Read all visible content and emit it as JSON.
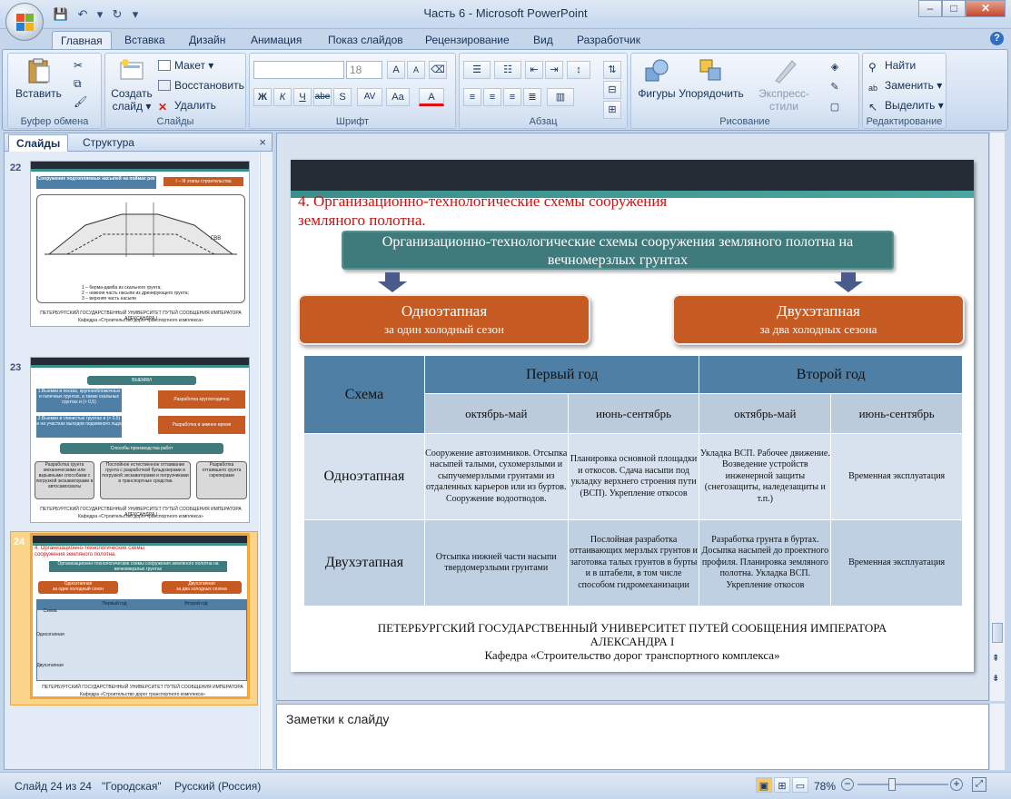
{
  "app": {
    "window_title": "Часть 6 - Microsoft PowerPoint"
  },
  "tabs": [
    "Главная",
    "Вставка",
    "Дизайн",
    "Анимация",
    "Показ слайдов",
    "Рецензирование",
    "Вид",
    "Разработчик"
  ],
  "ribbon": {
    "clipboard": {
      "paste": "Вставить",
      "label": "Буфер обмена"
    },
    "slides": {
      "create": "Создать",
      "create2": "слайд",
      "layout": "Макет",
      "reset": "Восстановить",
      "delete": "Удалить",
      "label": "Слайды"
    },
    "font": {
      "size": "18",
      "label": "Шрифт",
      "bold": "Ж",
      "italic": "К",
      "underline": "Ч",
      "strike": "abe",
      "shadow": "S",
      "grow": "A",
      "shrink": "A",
      "spacing": "AV",
      "case": "Aa",
      "color": "A"
    },
    "paragraph": {
      "label": "Абзац"
    },
    "drawing": {
      "shapes": "Фигуры",
      "arrange": "Упорядочить",
      "quick_styles": "Экспресс-стили",
      "label": "Рисование"
    },
    "editing": {
      "find": "Найти",
      "replace": "Заменить",
      "select": "Выделить",
      "label": "Редактирование"
    }
  },
  "panel": {
    "tab_slides": "Слайды",
    "tab_outline": "Структура",
    "thumbs": [
      {
        "num": "22",
        "title": "Сооружение подтопляемых насыпей на поймах рек",
        "badge": "I – III этапы строительства",
        "legend1": "1 – берма-дамба из скального грунта;",
        "legend2": "2 – нижняя часть насыпи из дренирующего грунта;",
        "legend3": "3 – верхняя часть насыпи",
        "footer": "ПЕТЕРБУРГСКИЙ ГОСУДАРСТВЕННЫЙ УНИВЕРСИТЕТ ПУТЕЙ СООБЩЕНИЯ ИМПЕРАТОРА АЛЕКСАНДРА I",
        "footer2": "Кафедра «Строительство дорог транспортного комплекса»",
        "gvv": "ГВВ"
      },
      {
        "num": "23",
        "head": "ВЫЕМКИ",
        "l1": "1.Выемки в песках, крупнообломочных и галечных грунтах, а также скальных грунтах и (> 0,5)",
        "r1": "Разработка круглогодично",
        "l2": "2.Выемки в глинистых грунтах и (> 0,5) и на участках выходов подземного льда",
        "r2": "Разработка в зимнее время",
        "methods": "Способы производства работ",
        "m1": "Разработка грунта механическими или взрывными способами с погрузкой экскаваторами в автосамосвалы",
        "m2": "Послойное естественное оттаивание грунта с разработкой бульдозерами и погрузкой экскаваторами и погрузчиками в транспортные средства",
        "m3": "Разработка оттаявшего грунта скреперами",
        "footer": "ПЕТЕРБУРГСКИЙ ГОСУДАРСТВЕННЫЙ УНИВЕРСИТЕТ ПУТЕЙ СООБЩЕНИЯ ИМПЕРАТОРА АЛЕКСАНДРА I",
        "footer2": "Кафедра «Строительство дорог транспортного комплекса»"
      },
      {
        "num": "24"
      }
    ]
  },
  "slide": {
    "title": "4. Организационно-технологические схемы сооружения земляного полотна.",
    "main_box": "Организационно-технологические схемы сооружения земляного полотна на вечномерзлых грунтах",
    "left_box": {
      "t1": "Одноэтапная",
      "t2": "за  один холодный сезон"
    },
    "right_box": {
      "t1": "Двухэтапная",
      "t2": "за  два холодных сезона"
    },
    "table": {
      "scheme": "Схема",
      "year1": "Первый год",
      "year2": "Второй год",
      "periods": [
        "октябрь-май",
        "июнь-сентябрь",
        "октябрь-май",
        "июнь-сентябрь"
      ],
      "rows": [
        {
          "name": "Одноэтапная",
          "cells": [
            "Сооружение автозимников. Отсыпка насыпей талыми, сухомерзлыми и сыпучемерзлыми грунтами из отдаленных карьеров или из буртов. Сооружение водоотводов.",
            "Планировка основной площадки и откосов. Сдача насыпи под укладку верхнего строения пути (ВСП). Укрепление откосов",
            "Укладка ВСП. Рабочее движение. Возведение устройств инженерной защиты (снегозащиты, наледезащиты и т.п.)",
            "Временная эксплуатация"
          ]
        },
        {
          "name": "Двухэтапная",
          "cells": [
            "Отсыпка нижней части насыпи твердомерзлыми грунтами",
            "Послойная разработка оттаивающих мерзлых грунтов и заготовка талых грунтов в бурты и в штабели, в том числе способом гидромеханизации",
            "Разработка грунта в буртах. Досыпка насыпей до проектного профиля. Планировка земляного полотна. Укладка ВСП. Укрепление откосов",
            "Временная эксплуатация"
          ]
        }
      ]
    },
    "footer1": "ПЕТЕРБУРГСКИЙ ГОСУДАРСТВЕННЫЙ УНИВЕРСИТЕТ ПУТЕЙ СООБЩЕНИЯ ИМПЕРАТОРА",
    "footer2": "АЛЕКСАНДРА I",
    "footer3": "Кафедра «Строительство дорог транспортного комплекса»"
  },
  "notes": {
    "placeholder": "Заметки к слайду"
  },
  "status": {
    "slide": "Слайд 24 из 24",
    "theme": "\"Городская\"",
    "lang": "Русский (Россия)",
    "zoom": "78%"
  }
}
